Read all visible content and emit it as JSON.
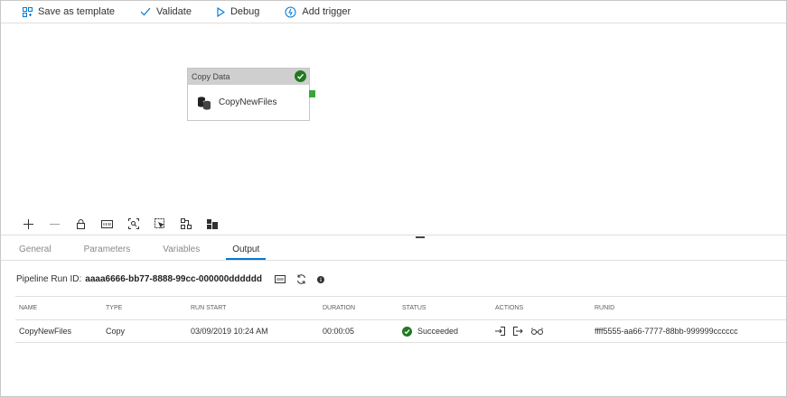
{
  "toolbar": {
    "save_as_template": "Save as template",
    "validate": "Validate",
    "debug": "Debug",
    "add_trigger": "Add trigger"
  },
  "canvas": {
    "activity": {
      "header": "Copy Data",
      "name": "CopyNewFiles",
      "status": "succeeded"
    }
  },
  "canvas_tools": [
    "add-icon",
    "remove-icon",
    "lock-icon",
    "zoom-100-icon",
    "zoom-to-fit-icon",
    "select-icon",
    "auto-align-icon",
    "layout-icon"
  ],
  "tabs": [
    {
      "label": "General",
      "active": false
    },
    {
      "label": "Parameters",
      "active": false
    },
    {
      "label": "Variables",
      "active": false
    },
    {
      "label": "Output",
      "active": true
    }
  ],
  "output": {
    "run_id_label": "Pipeline Run ID:",
    "run_id": "aaaa6666-bb77-8888-99cc-000000dddddd",
    "columns": {
      "name": "NAME",
      "type": "TYPE",
      "run_start": "RUN START",
      "duration": "DURATION",
      "status": "STATUS",
      "actions": "ACTIONS",
      "runid": "RUNID"
    },
    "rows": [
      {
        "name": "CopyNewFiles",
        "type": "Copy",
        "run_start": "03/09/2019 10:24 AM",
        "duration": "00:00:05",
        "status": "Succeeded",
        "runid": "ffff5555-aa66-7777-88bb-999999cccccc"
      }
    ]
  },
  "colors": {
    "accent": "#0078d4",
    "success": "#1f7a1f",
    "connector": "#3aa63a"
  }
}
